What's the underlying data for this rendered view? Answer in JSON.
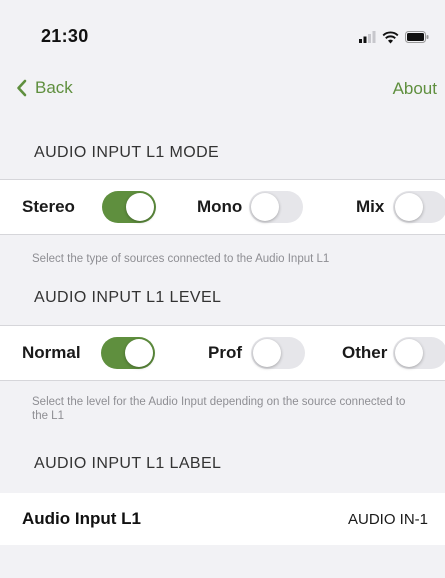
{
  "status_bar": {
    "time": "21:30"
  },
  "nav": {
    "back_label": "Back",
    "about_label": "About"
  },
  "mode_section": {
    "header": "AUDIO INPUT L1 MODE",
    "options": [
      {
        "label": "Stereo",
        "on": true
      },
      {
        "label": "Mono",
        "on": false
      },
      {
        "label": "Mix",
        "on": false
      }
    ],
    "footnote": "Select the type of sources connected to the Audio Input L1"
  },
  "level_section": {
    "header": "AUDIO INPUT L1 LEVEL",
    "options": [
      {
        "label": "Normal",
        "on": true
      },
      {
        "label": "Prof",
        "on": false
      },
      {
        "label": "Other",
        "on": false
      }
    ],
    "footnote": "Select the level for the Audio Input depending on the source connected to the L1"
  },
  "label_section": {
    "header": "AUDIO INPUT L1 LABEL",
    "field_name": "Audio Input L1",
    "field_value": "AUDIO IN-1"
  },
  "colors": {
    "accent": "#5f8f3e",
    "background": "#f2f2f5",
    "toggle_off": "#e6e6ea"
  }
}
